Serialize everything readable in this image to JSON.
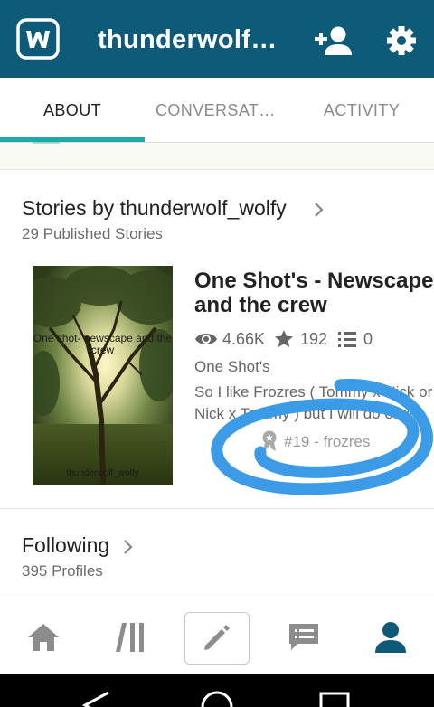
{
  "header": {
    "title": "thunderwolf_wolfy",
    "logo_icon": "wattpad-w-logo",
    "icons": [
      "add-user-icon",
      "gear-icon"
    ]
  },
  "tabs": [
    {
      "label": "ABOUT",
      "active": true
    },
    {
      "label": "CONVERSATIONS",
      "active": false
    },
    {
      "label": "ACTIVITY",
      "active": false
    }
  ],
  "stories": {
    "title": "Stories by thunderwolf_wolfy",
    "count_text": "29 Published Stories",
    "item": {
      "cover_title": "One shot- newscape and the crew",
      "cover_author": "thunderwolf_wolfy",
      "title": "One Shot's - Newscape and the crew",
      "reads": "4.66K",
      "votes": "192",
      "parts": "0",
      "category": "One Shot's",
      "description_line1": "So I like Frozres ( Tommy x Nick or",
      "description_line2": "Nick x Tommy ) but I will do other",
      "rank": "#19 - frozres"
    }
  },
  "following": {
    "title": "Following",
    "count_text": "395 Profiles"
  },
  "bottom_nav": [
    "home-icon",
    "library-icon",
    "write-icon",
    "messages-icon",
    "profile-icon"
  ],
  "colors": {
    "header": "#0d5a79",
    "accent": "#1fa9a8",
    "active_nav": "#0d5a79",
    "annotation": "#3b9be6"
  }
}
